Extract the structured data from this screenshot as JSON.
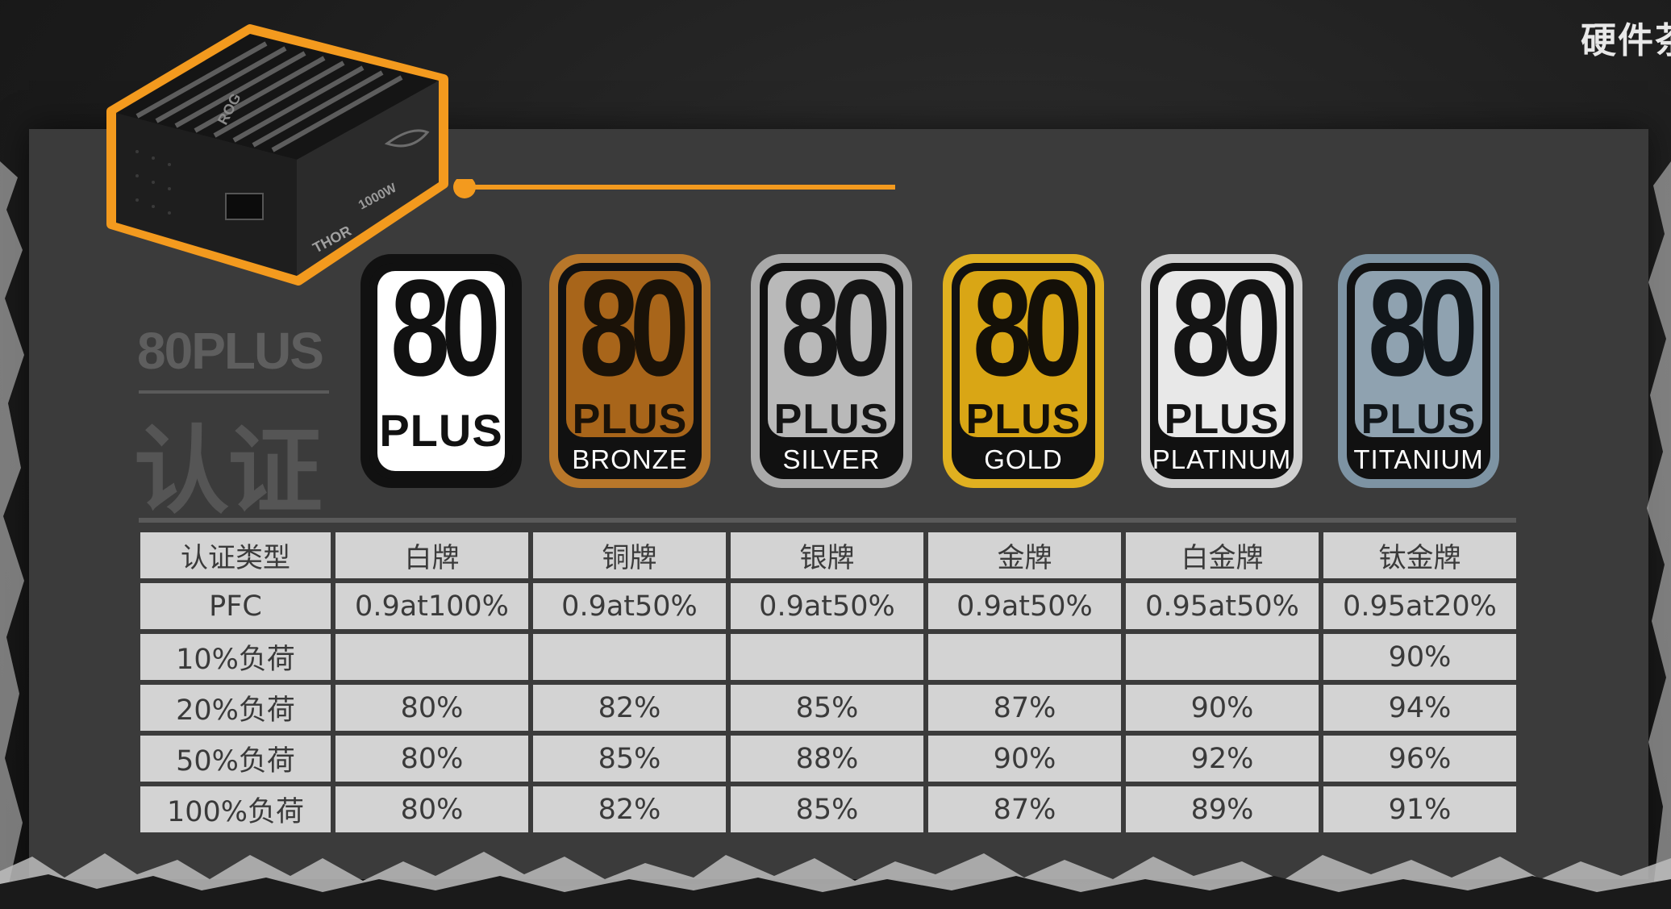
{
  "watermark": "硬件茶",
  "psu": {
    "brand_mark": "ROG",
    "model_label": "THOR",
    "wattage_label": "1000W"
  },
  "heading": {
    "title_en": "80PLUS",
    "title_cn": "认证"
  },
  "badges": [
    {
      "number": "80",
      "plus": "PLUS",
      "tier": "",
      "bg": "#ffffff",
      "frame": "#111111",
      "ink": "#111111",
      "plus_bg": "#ffffff",
      "plus_ink": "#111111"
    },
    {
      "number": "80",
      "plus": "PLUS",
      "tier": "BRONZE",
      "bg": "#a8651a",
      "frame": "#b8772a",
      "ink": "#1a1208",
      "plus_bg": "#a8651a",
      "plus_ink": "#1a1208"
    },
    {
      "number": "80",
      "plus": "PLUS",
      "tier": "SILVER",
      "bg": "#b9b9b9",
      "frame": "#a9a9a9",
      "ink": "#151515",
      "plus_bg": "#b9b9b9",
      "plus_ink": "#151515"
    },
    {
      "number": "80",
      "plus": "PLUS",
      "tier": "GOLD",
      "bg": "#d9a615",
      "frame": "#e0b020",
      "ink": "#141008",
      "plus_bg": "#d9a615",
      "plus_ink": "#141008"
    },
    {
      "number": "80",
      "plus": "PLUS",
      "tier": "PLATINUM",
      "bg": "#e8e8e8",
      "frame": "#cfcfcf",
      "ink": "#141414",
      "plus_bg": "#e8e8e8",
      "plus_ink": "#141414"
    },
    {
      "number": "80",
      "plus": "PLUS",
      "tier": "TITANIUM",
      "bg": "#8fa2b0",
      "frame": "#7d93a3",
      "ink": "#12171b",
      "plus_bg": "#8fa2b0",
      "plus_ink": "#12171b"
    }
  ],
  "table": {
    "headers": [
      "认证类型",
      "白牌",
      "铜牌",
      "银牌",
      "金牌",
      "白金牌",
      "钛金牌"
    ],
    "rows": [
      [
        "PFC",
        "0.9at100%",
        "0.9at50%",
        "0.9at50%",
        "0.9at50%",
        "0.95at50%",
        "0.95at20%"
      ],
      [
        "10%负荷",
        "",
        "",
        "",
        "",
        "",
        "90%"
      ],
      [
        "20%负荷",
        "80%",
        "82%",
        "85%",
        "87%",
        "90%",
        "94%"
      ],
      [
        "50%负荷",
        "80%",
        "85%",
        "88%",
        "90%",
        "92%",
        "96%"
      ],
      [
        "100%负荷",
        "80%",
        "82%",
        "85%",
        "87%",
        "89%",
        "91%"
      ]
    ]
  },
  "colors": {
    "accent": "#f39a1e",
    "card": "#3b3b3b",
    "cell": "#d3d3d3"
  }
}
